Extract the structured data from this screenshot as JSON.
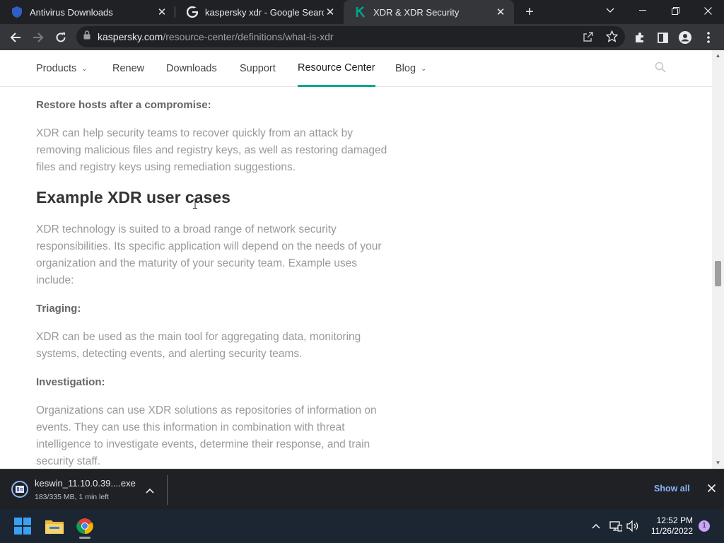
{
  "browser": {
    "tabs": [
      {
        "title": "Antivirus Downloads",
        "favicon": "shield-favicon"
      },
      {
        "title": "kaspersky xdr - Google Search",
        "favicon": "google-favicon"
      },
      {
        "title": "XDR & XDR Security",
        "favicon": "kaspersky-favicon",
        "active": true
      }
    ],
    "url_domain": "kaspersky.com",
    "url_path": "/resource-center/definitions/what-is-xdr"
  },
  "site_nav": {
    "items": [
      {
        "label": "Products",
        "has_dropdown": true
      },
      {
        "label": "Renew"
      },
      {
        "label": "Downloads"
      },
      {
        "label": "Support"
      },
      {
        "label": "Resource Center",
        "active": true
      },
      {
        "label": "Blog",
        "has_dropdown": true
      }
    ],
    "dropdown_glyph": "⌄"
  },
  "article": {
    "restore_heading": "Restore hosts after a compromise:",
    "restore_text": "XDR can help security teams to recover quickly from an attack by removing malicious files and registry keys, as well as restoring damaged files and registry keys using remediation suggestions.",
    "cases_heading": "Example XDR user cases",
    "cases_text": "XDR technology is suited to a broad range of network security responsibilities. Its specific application will depend on the needs of your organization and the maturity of your security team. Example uses include:",
    "triaging_heading": "Triaging:",
    "triaging_text": "XDR can be used as the main tool for aggregating data, monitoring systems, detecting events, and alerting security teams.",
    "investigation_heading": "Investigation:",
    "investigation_text": "Organizations can use XDR solutions as repositories of information on events. They can use this information in combination with threat intelligence to investigate events, determine their response, and train security staff."
  },
  "download": {
    "filename": "keswin_11.10.0.39....exe",
    "status": "183/335 MB, 1 min left",
    "show_all": "Show all"
  },
  "taskbar": {
    "time": "12:52 PM",
    "date": "11/26/2022",
    "notifications": "1"
  },
  "colors": {
    "accent": "#00a88e",
    "link": "#8ab4f8"
  }
}
